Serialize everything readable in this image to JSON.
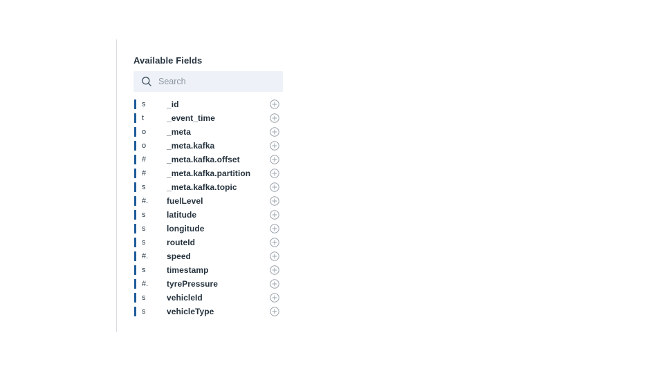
{
  "panel": {
    "title": "Available Fields",
    "search": {
      "icon": "search-icon",
      "placeholder": "Search",
      "value": ""
    },
    "add_icon": "plus-circle-icon",
    "accent_color": "#1f5c99",
    "title_color": "#27343f",
    "search_background": "#eef2f8",
    "border_color": "#d9dde3",
    "fields": [
      {
        "type": "s",
        "name": "_id"
      },
      {
        "type": "t",
        "name": "_event_time"
      },
      {
        "type": "o",
        "name": "_meta"
      },
      {
        "type": "o",
        "name": "_meta.kafka"
      },
      {
        "type": "#",
        "name": "_meta.kafka.offset"
      },
      {
        "type": "#",
        "name": "_meta.kafka.partition"
      },
      {
        "type": "s",
        "name": "_meta.kafka.topic"
      },
      {
        "type": "#.",
        "name": "fuelLevel"
      },
      {
        "type": "s",
        "name": "latitude"
      },
      {
        "type": "s",
        "name": "longitude"
      },
      {
        "type": "s",
        "name": "routeId"
      },
      {
        "type": "#.",
        "name": "speed"
      },
      {
        "type": "s",
        "name": "timestamp"
      },
      {
        "type": "#.",
        "name": "tyrePressure"
      },
      {
        "type": "s",
        "name": "vehicleId"
      },
      {
        "type": "s",
        "name": "vehicleType"
      }
    ]
  }
}
